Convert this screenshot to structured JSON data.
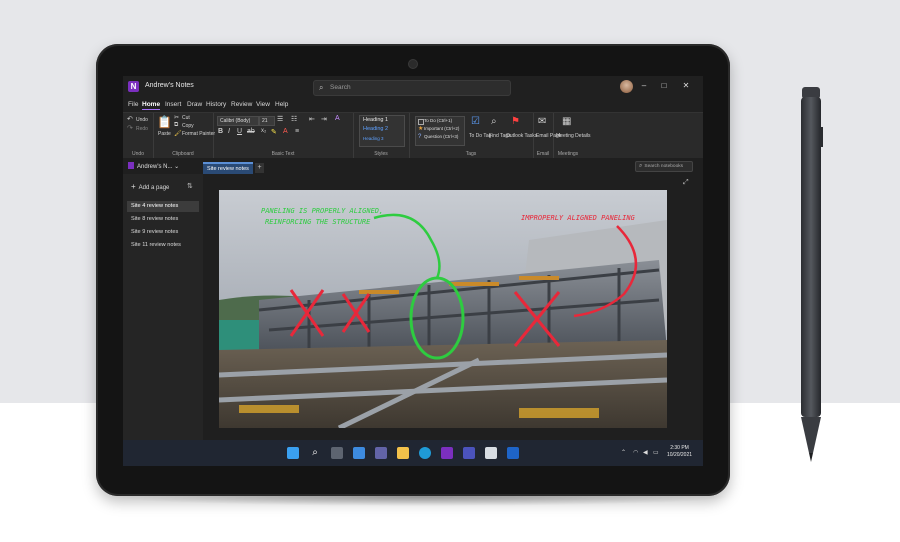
{
  "app": {
    "title": "Andrew's Notes",
    "logo_letter": "N",
    "search_placeholder": "Search",
    "window_controls": [
      "–",
      "□",
      "✕"
    ]
  },
  "menu": {
    "items": [
      "File",
      "Home",
      "Insert",
      "Draw",
      "History",
      "Review",
      "View",
      "Help"
    ],
    "active": "Home"
  },
  "ribbon": {
    "undo": {
      "undo": "Undo",
      "redo": "Redo",
      "group": "Undo"
    },
    "clipboard": {
      "paste": "Paste",
      "cut": "Cut",
      "copy": "Copy",
      "format_painter": "Format Painter",
      "group": "Clipboard"
    },
    "basic_text": {
      "font": "Calibri (Body)",
      "size": "21",
      "group": "Basic Text"
    },
    "styles": {
      "heading1": "Heading 1",
      "heading2": "Heading 2",
      "heading3": "Heading 3",
      "group": "Styles"
    },
    "tags": {
      "todo": "To Do (Ctrl+1)",
      "important": "Important (Ctrl+2)",
      "question": "Question (Ctrl+3)",
      "todo_tag": "To Do Tag",
      "find_tags": "Find Tags",
      "outlook_tasks": "Outlook Tasks",
      "group": "Tags"
    },
    "email": {
      "email_page": "Email Page",
      "group": "Email"
    },
    "meetings": {
      "meeting_details": "Meeting Details",
      "group": "Meetings"
    }
  },
  "notebook": {
    "name": "Andrew's N...",
    "active_tab": "Site review notes",
    "search_placeholder": "Search notebooks"
  },
  "pages": {
    "add_label": "Add a page",
    "items": [
      "Site 4 review notes",
      "Site 8 review notes",
      "Site 9 review notes",
      "Site 11 review notes"
    ],
    "selected_index": 0
  },
  "annotations": {
    "green_note_line1": "PANELING IS PROPERLY ALIGNED,",
    "green_note_line2": "REINFORCING THE STRUCTURE",
    "red_note": "IMPROPERLY ALIGNED PANELING"
  },
  "taskbar": {
    "time": "2:30 PM",
    "date": "10/20/2021"
  },
  "colors": {
    "accent": "#a370f7",
    "onenote_purple": "#7b2fbf",
    "green_ink": "#2ecc40",
    "red_ink": "#e8283a"
  }
}
